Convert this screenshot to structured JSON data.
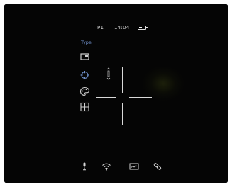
{
  "status": {
    "profile": "P1",
    "time": "14:04",
    "battery_level": 0.5
  },
  "menu": {
    "title": "Type",
    "items": [
      {
        "icon": "picture-in-picture-icon"
      },
      {
        "icon": "crosshair-target-icon"
      },
      {
        "icon": "palette-icon"
      },
      {
        "icon": "grid-layout-icon"
      }
    ]
  },
  "bottom_bar": {
    "icons": [
      "microphone-icon",
      "wifi-icon",
      "video-record-icon",
      "link-icon"
    ]
  },
  "colors": {
    "accent": "#6f8fc9",
    "foreground": "#d9d9d9",
    "background": "#050505"
  }
}
